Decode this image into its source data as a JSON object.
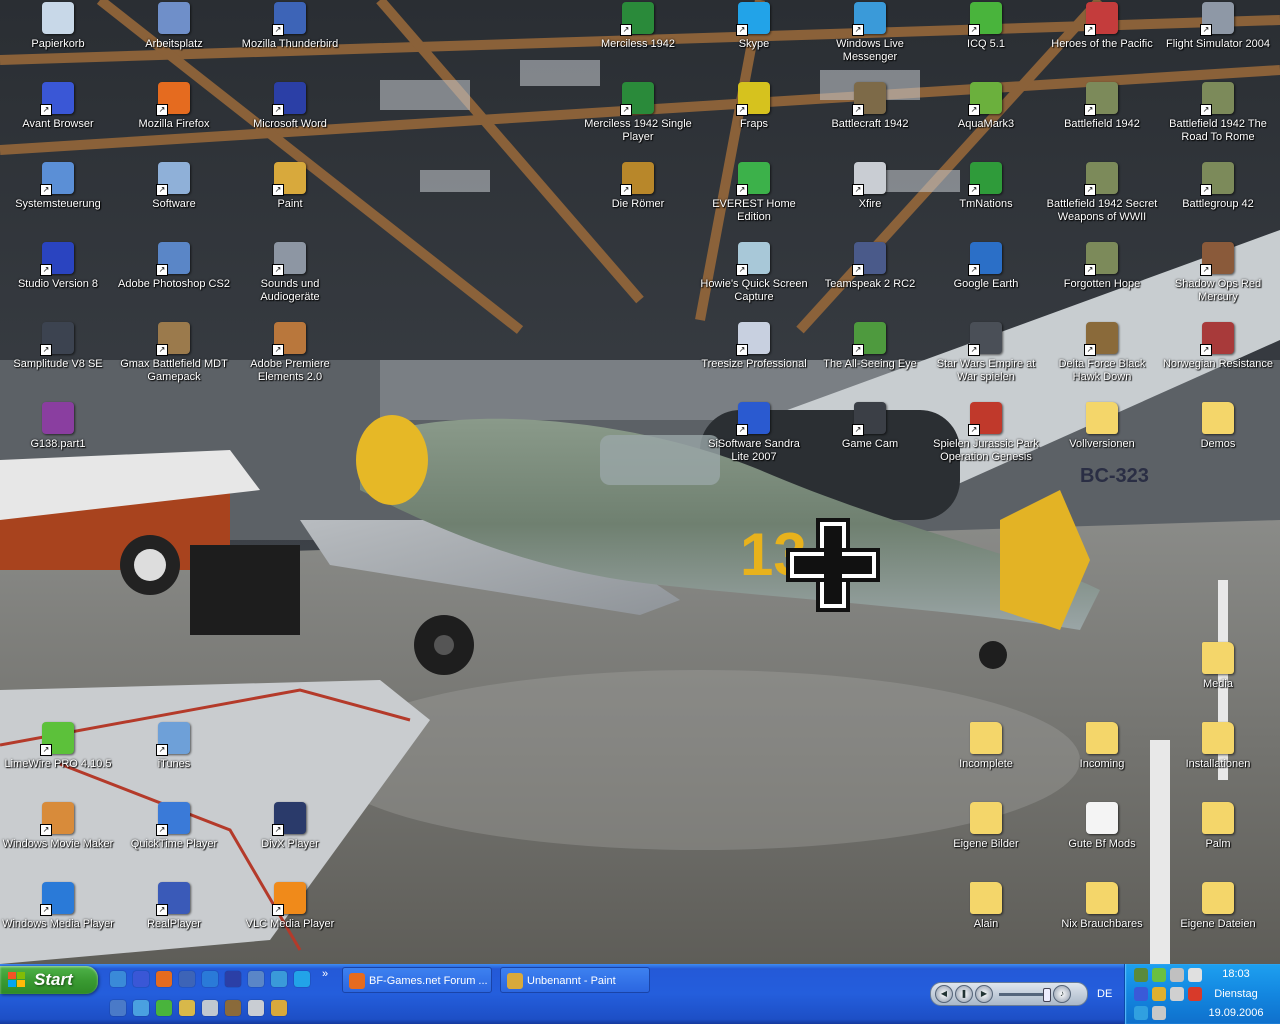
{
  "desktop": {
    "icons": [
      {
        "label": "Papierkorb",
        "icon": "recycle-bin-icon",
        "color": "#c8d8e8"
      },
      {
        "label": "Arbeitsplatz",
        "icon": "my-computer-icon",
        "color": "#6f8fc9"
      },
      {
        "label": "Mozilla Thunderbird",
        "icon": "thunderbird-icon",
        "color": "#3d64b7"
      },
      {
        "label": "Avant Browser",
        "icon": "avant-browser-icon",
        "color": "#3a57d6"
      },
      {
        "label": "Mozilla Firefox",
        "icon": "firefox-icon",
        "color": "#e56b1f"
      },
      {
        "label": "Microsoft Word",
        "icon": "word-icon",
        "color": "#2b3fa6"
      },
      {
        "label": "Systemsteuerung",
        "icon": "control-panel-icon",
        "color": "#5b8fd6"
      },
      {
        "label": "Software",
        "icon": "software-icon",
        "color": "#8fb0d8"
      },
      {
        "label": "Paint",
        "icon": "paint-icon",
        "color": "#d8a93c"
      },
      {
        "label": "Studio Version 8",
        "icon": "studio-icon",
        "color": "#2a44c0"
      },
      {
        "label": "Adobe Photoshop CS2",
        "icon": "photoshop-icon",
        "color": "#5a86c7"
      },
      {
        "label": "Sounds und Audiogeräte",
        "icon": "sounds-icon",
        "color": "#8d96a3"
      },
      {
        "label": "Samplitude V8 SE",
        "icon": "samplitude-icon",
        "color": "#3c4350"
      },
      {
        "label": "Gmax Battlefield MDT Gamepack",
        "icon": "gmax-icon",
        "color": "#9b7a4c"
      },
      {
        "label": "Adobe Premiere Elements 2.0",
        "icon": "premiere-icon",
        "color": "#b9773c"
      },
      {
        "label": "G138.part1",
        "icon": "rar-archive-icon",
        "color": "#8a3ea0"
      },
      {
        "label": "Merciless 1942",
        "icon": "merciless-icon",
        "color": "#2a8a3a"
      },
      {
        "label": "Skype",
        "icon": "skype-icon",
        "color": "#22a3e8"
      },
      {
        "label": "Windows Live Messenger",
        "icon": "messenger-icon",
        "color": "#3a9ad9"
      },
      {
        "label": "ICQ 5.1",
        "icon": "icq-icon",
        "color": "#49b43c"
      },
      {
        "label": "Heroes of the Pacific",
        "icon": "heroes-pacific-icon",
        "color": "#c43c3c"
      },
      {
        "label": "Flight Simulator 2004",
        "icon": "flight-sim-icon",
        "color": "#8e98a6"
      },
      {
        "label": "Merciless 1942 Single Player",
        "icon": "merciless-sp-icon",
        "color": "#2a8a3a"
      },
      {
        "label": "Fraps",
        "icon": "fraps-icon",
        "color": "#d6c21e"
      },
      {
        "label": "Battlecraft 1942",
        "icon": "battlecraft-icon",
        "color": "#7d6a48"
      },
      {
        "label": "AquaMark3",
        "icon": "aquamark-icon",
        "color": "#6bb03d"
      },
      {
        "label": "Battlefield 1942",
        "icon": "bf1942-icon",
        "color": "#7c8a5a"
      },
      {
        "label": "Battlefield 1942 The Road To Rome",
        "icon": "bf1942-rtr-icon",
        "color": "#7c8a5a"
      },
      {
        "label": "Die Römer",
        "icon": "die-roemer-icon",
        "color": "#b8872a"
      },
      {
        "label": "EVEREST Home Edition",
        "icon": "everest-icon",
        "color": "#3cb14a"
      },
      {
        "label": "Xfire",
        "icon": "xfire-icon",
        "color": "#c9cdd3"
      },
      {
        "label": "TmNations",
        "icon": "tmnations-icon",
        "color": "#2f9b3a"
      },
      {
        "label": "Battlefield 1942 Secret Weapons of WWII",
        "icon": "bf1942-sw-icon",
        "color": "#7c8a5a"
      },
      {
        "label": "Battlegroup 42",
        "icon": "battlegroup-icon",
        "color": "#7c8a5a"
      },
      {
        "label": "Howie's Quick Screen Capture",
        "icon": "screen-capture-icon",
        "color": "#a8c8d8"
      },
      {
        "label": "Teamspeak 2 RC2",
        "icon": "teamspeak-icon",
        "color": "#4a5a8a"
      },
      {
        "label": "Google Earth",
        "icon": "google-earth-icon",
        "color": "#2b6fc7"
      },
      {
        "label": "Forgotten Hope",
        "icon": "forgotten-hope-icon",
        "color": "#7c8a5a"
      },
      {
        "label": "Shadow Ops Red Mercury",
        "icon": "shadow-ops-icon",
        "color": "#8a5a3a"
      },
      {
        "label": "Treesize Professional",
        "icon": "treesize-icon",
        "color": "#c8d0e0"
      },
      {
        "label": "The All-Seeing Eye",
        "icon": "all-seeing-eye-icon",
        "color": "#4e9a3e"
      },
      {
        "label": "Star Wars Empire at War spielen",
        "icon": "star-wars-icon",
        "color": "#4a4f57"
      },
      {
        "label": "Delta Force Black Hawk Down",
        "icon": "delta-force-icon",
        "color": "#8a6a3a"
      },
      {
        "label": "Norwegian Resistance",
        "icon": "norwegian-resistance-icon",
        "color": "#a83a3a"
      },
      {
        "label": "SiSoftware Sandra Lite 2007",
        "icon": "sandra-icon",
        "color": "#2a5ad0"
      },
      {
        "label": "Game Cam",
        "icon": "game-cam-icon",
        "color": "#3b3f46"
      },
      {
        "label": "Spielen Jurassic Park Operation Genesis",
        "icon": "jurassic-park-icon",
        "color": "#c0392b"
      },
      {
        "label": "Vollversionen",
        "icon": "folder-icon",
        "color": "#f4d66a"
      },
      {
        "label": "Demos",
        "icon": "folder-icon",
        "color": "#f4d66a"
      },
      {
        "label": "Media",
        "icon": "folder-icon",
        "color": "#f4d66a"
      },
      {
        "label": "LimeWire PRO 4.10.5",
        "icon": "limewire-icon",
        "color": "#5cc13a"
      },
      {
        "label": "iTunes",
        "icon": "itunes-icon",
        "color": "#6ea0d8"
      },
      {
        "label": "Incomplete",
        "icon": "folder-icon",
        "color": "#f4d66a"
      },
      {
        "label": "Incoming",
        "icon": "folder-icon",
        "color": "#f4d66a"
      },
      {
        "label": "Installationen",
        "icon": "folder-icon",
        "color": "#f4d66a"
      },
      {
        "label": "Windows Movie Maker",
        "icon": "movie-maker-icon",
        "color": "#d88b3a"
      },
      {
        "label": "QuickTime Player",
        "icon": "quicktime-icon",
        "color": "#3a7ad8"
      },
      {
        "label": "DivX Player",
        "icon": "divx-icon",
        "color": "#2a3a6a"
      },
      {
        "label": "Eigene Bilder",
        "icon": "my-pictures-icon",
        "color": "#f4d66a"
      },
      {
        "label": "Gute Bf Mods",
        "icon": "text-file-icon",
        "color": "#f4f4f4"
      },
      {
        "label": "Palm",
        "icon": "folder-icon",
        "color": "#f4d66a"
      },
      {
        "label": "Windows Media Player",
        "icon": "media-player-icon",
        "color": "#2a7ad8"
      },
      {
        "label": "RealPlayer",
        "icon": "realplayer-icon",
        "color": "#3a5ab8"
      },
      {
        "label": "VLC Media Player",
        "icon": "vlc-icon",
        "color": "#f08a1a"
      },
      {
        "label": "Alain",
        "icon": "folder-icon",
        "color": "#f4d66a"
      },
      {
        "label": "Nix Brauchbares",
        "icon": "folder-icon",
        "color": "#f4d66a"
      },
      {
        "label": "Eigene Dateien",
        "icon": "my-documents-icon",
        "color": "#f4d66a"
      }
    ]
  },
  "taskbar": {
    "start_label": "Start",
    "quick_launch": [
      {
        "icon": "ie-icon",
        "color": "#3a8ad8"
      },
      {
        "icon": "avant-icon",
        "color": "#3a57d6"
      },
      {
        "icon": "firefox-icon",
        "color": "#e56b1f"
      },
      {
        "icon": "thunderbird-icon",
        "color": "#3d64b7"
      },
      {
        "icon": "media-player-icon",
        "color": "#2a7ad8"
      },
      {
        "icon": "word-icon",
        "color": "#2b3fa6"
      },
      {
        "icon": "photoshop-icon",
        "color": "#5a86c7"
      },
      {
        "icon": "messenger-icon",
        "color": "#3a9ad9"
      },
      {
        "icon": "skype-icon",
        "color": "#22a3e8"
      },
      {
        "icon": "show-desktop-icon",
        "color": "#4a7ac8"
      },
      {
        "icon": "search-icon",
        "color": "#4aa0e0"
      },
      {
        "icon": "icq-icon",
        "color": "#49b43c"
      },
      {
        "icon": "explorer-icon",
        "color": "#d8b84a"
      },
      {
        "icon": "calculator-icon",
        "color": "#c0c8d0"
      },
      {
        "icon": "game-icon",
        "color": "#8a6a3a"
      },
      {
        "icon": "xfire-icon",
        "color": "#c9cdd3"
      },
      {
        "icon": "paint-icon",
        "color": "#d8a93c"
      }
    ],
    "more_label": "»",
    "tasks": [
      {
        "label": "BF-Games.net Forum ...",
        "icon": "firefox-icon",
        "color": "#e56b1f"
      },
      {
        "label": "Unbenannt - Paint",
        "icon": "paint-icon",
        "color": "#d8a93c"
      }
    ],
    "language": "DE",
    "clock": {
      "time": "18:03",
      "day": "Dienstag",
      "date": "19.09.2006"
    },
    "tray_icons": [
      {
        "icon": "network-icon",
        "color": "#5a8a3a"
      },
      {
        "icon": "messenger-tray-icon",
        "color": "#6ac040"
      },
      {
        "icon": "game-tray-icon",
        "color": "#c0c0c0"
      },
      {
        "icon": "monitor-tray-icon",
        "color": "#e0e0e0"
      },
      {
        "icon": "firewall-tray-icon",
        "color": "#3a5ad8"
      },
      {
        "icon": "update-tray-icon",
        "color": "#e0b030"
      },
      {
        "icon": "volume-tray-icon",
        "color": "#d0d0d0"
      },
      {
        "icon": "antivirus-tray-icon",
        "color": "#d83a2a"
      },
      {
        "icon": "search-tray-icon",
        "color": "#30a0e0"
      },
      {
        "icon": "messenger2-tray-icon",
        "color": "#c8c8c8"
      }
    ]
  }
}
